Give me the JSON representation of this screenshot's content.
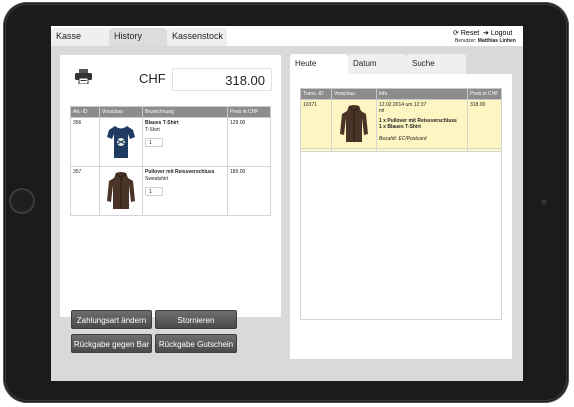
{
  "tabs": [
    "Kasse",
    "History",
    "Kassenstock"
  ],
  "header": {
    "reset_label": "Reset",
    "logout_label": "Logout",
    "user_prefix": "Benutzer:",
    "user_name": "Matthias Linhen"
  },
  "cart": {
    "currency": "CHF",
    "total": "318.00",
    "columns": [
      "Art.-ID",
      "Vorschau",
      "Bezeichnung",
      "Preis in CHF"
    ],
    "rows": [
      {
        "id": "356",
        "name": "Blaues T-Shirt",
        "type": "T-Shirt",
        "qty": "1",
        "price": "129.00",
        "icon": "tshirt-icon"
      },
      {
        "id": "357",
        "name": "Pullover mit Reissverschluss",
        "type": "Sweatshirt",
        "qty": "1",
        "price": "189.00",
        "icon": "hoodie-icon"
      }
    ]
  },
  "actions": {
    "change_payment": "Zahlungsart ändern",
    "cancel": "Stornieren",
    "return_cash": "Rückgabe gegen Bar",
    "return_voucher": "Rückgabe Gutschein"
  },
  "history": {
    "tabs": [
      "Heute",
      "Datum",
      "Suche"
    ],
    "columns": [
      "Trans.-ID",
      "Vorschau",
      "Info",
      "Preis in CHF"
    ],
    "rows": [
      {
        "id": "10371",
        "date_line": "12.02.2014 um 12:37",
        "unit_line": "ml",
        "item1": "1 x Pullover mit Reissverschluss",
        "item2": "1 x Blaues T-Shirt",
        "paid": "Bezahlt: EC/Postcard",
        "price": "318.00"
      }
    ]
  },
  "colors": {
    "highlight_row": "#fdf6c3",
    "button_dark": "#555555",
    "header_grey": "#8c8c8c"
  }
}
